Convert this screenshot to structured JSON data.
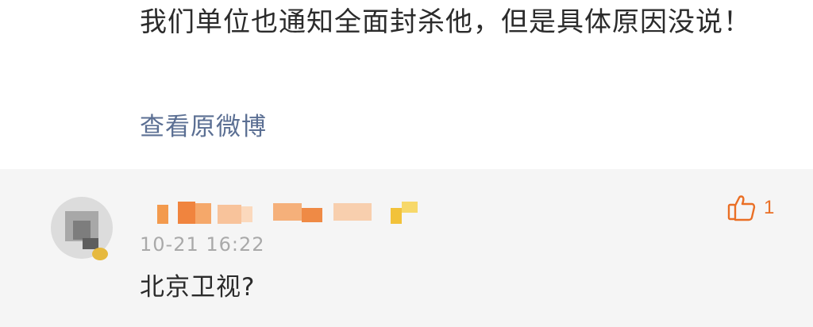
{
  "post": {
    "text": "我们单位也通知全面封杀他，但是具体原因没说！",
    "view_original_label": "查看原微博"
  },
  "comment": {
    "timestamp": "10-21 16:22",
    "text": "北京卫视?",
    "like_count": "1",
    "like_icon": "thumbs-up-icon"
  },
  "colors": {
    "link": "#5b6f93",
    "like_accent": "#ea6f25",
    "comment_bg": "#f5f5f5",
    "timestamp": "#a9a9a9"
  }
}
